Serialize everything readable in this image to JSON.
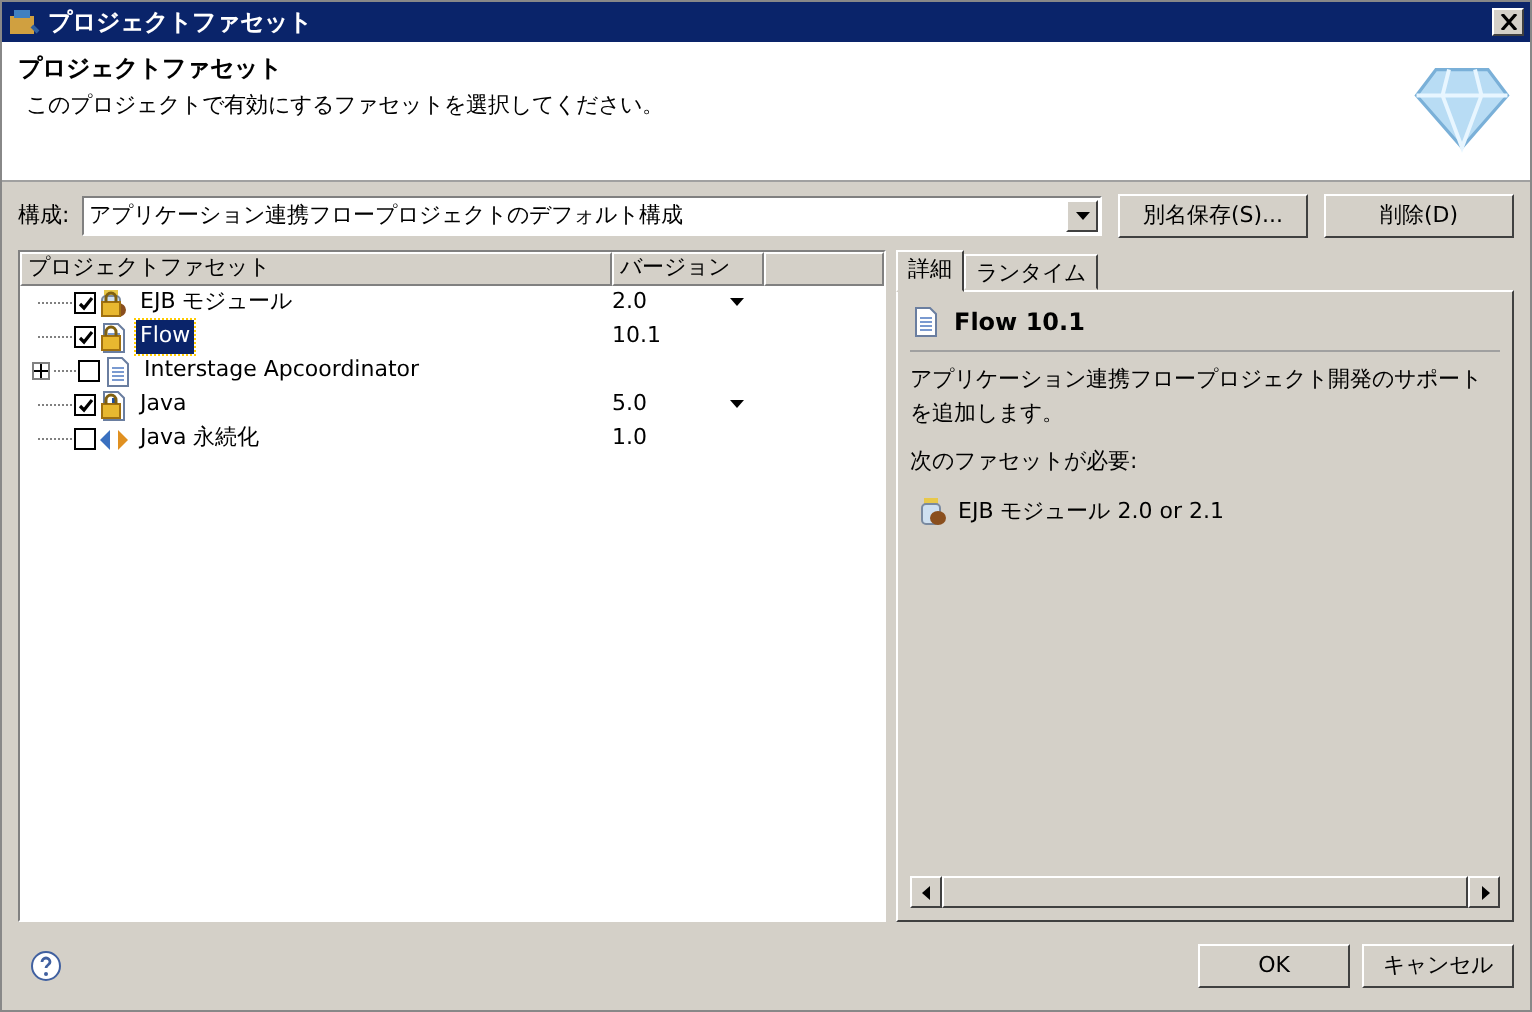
{
  "window": {
    "title": "プロジェクトファセット"
  },
  "header": {
    "title": "プロジェクトファセット",
    "description": "このプロジェクトで有効にするファセットを選択してください。"
  },
  "configuration": {
    "label": "構成:",
    "value": "アプリケーション連携フロープロジェクトのデフォルト構成",
    "buttons": [
      "別名保存(S)...",
      "削除(D)"
    ]
  },
  "tree": {
    "columns": [
      "プロジェクトファセット",
      "バージョン"
    ],
    "rows": [
      {
        "label": "EJB モジュール",
        "version": "2.0",
        "checked": true,
        "locked": true,
        "selected": false,
        "expandable": false,
        "dropdown": true,
        "kind": "bean"
      },
      {
        "label": "Flow",
        "version": "10.1",
        "checked": true,
        "locked": true,
        "selected": true,
        "expandable": false,
        "dropdown": false,
        "kind": "document"
      },
      {
        "label": "Interstage Apcoordinator",
        "checked": false,
        "locked": false,
        "selected": false,
        "expandable": true,
        "dropdown": false,
        "kind": "document"
      },
      {
        "label": "Java",
        "version": "5.0",
        "checked": true,
        "locked": true,
        "selected": false,
        "expandable": false,
        "dropdown": true,
        "kind": "java"
      },
      {
        "label": "Java 永続化",
        "version": "1.0",
        "checked": false,
        "locked": false,
        "selected": false,
        "expandable": false,
        "dropdown": false,
        "kind": "arrows"
      }
    ]
  },
  "details": {
    "tabs": [
      {
        "label": "詳細",
        "selected": true
      },
      {
        "label": "ランタイム",
        "selected": false
      }
    ],
    "title": "Flow 10.1",
    "description": "アプリケーション連携フロープロジェクト開発のサポートを追加します。",
    "requires_label": "次のファセットが必要:",
    "requirements": [
      "EJB モジュール 2.0 or 2.1"
    ]
  },
  "footer": {
    "buttons": [
      "OK",
      "キャンセル"
    ]
  }
}
